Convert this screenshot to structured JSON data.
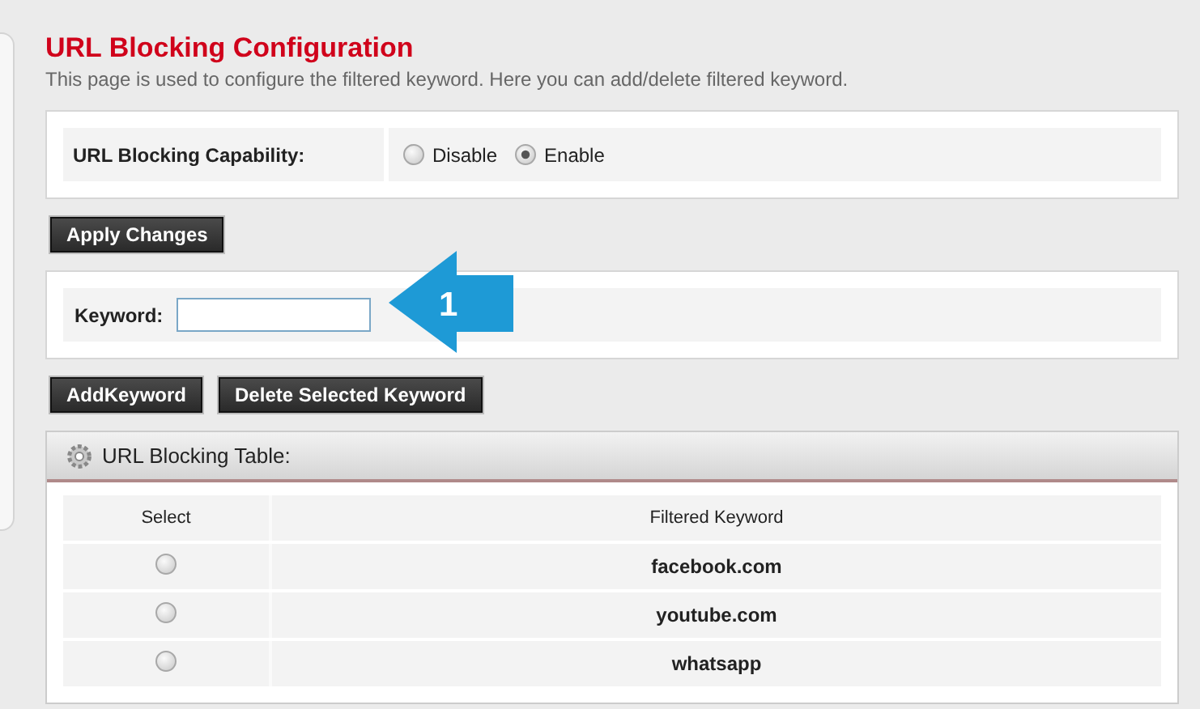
{
  "title": "URL Blocking Configuration",
  "description": "This page is used to configure the filtered keyword. Here you can add/delete filtered keyword.",
  "capability": {
    "label": "URL Blocking Capability:",
    "options": [
      {
        "label": "Disable",
        "selected": false
      },
      {
        "label": "Enable",
        "selected": true
      }
    ]
  },
  "apply_button": "Apply Changes",
  "keyword_field": {
    "label": "Keyword:"
  },
  "buttons": [
    "AddKeyword",
    "Delete Selected Keyword"
  ],
  "annotation": {
    "label": "1"
  },
  "table": {
    "title": "URL Blocking Table:",
    "columns": [
      "Select",
      "Filtered Keyword"
    ],
    "rows": [
      {
        "selected": false,
        "keyword": "facebook.com"
      },
      {
        "selected": false,
        "keyword": "youtube.com"
      },
      {
        "selected": false,
        "keyword": "whatsapp"
      }
    ]
  }
}
